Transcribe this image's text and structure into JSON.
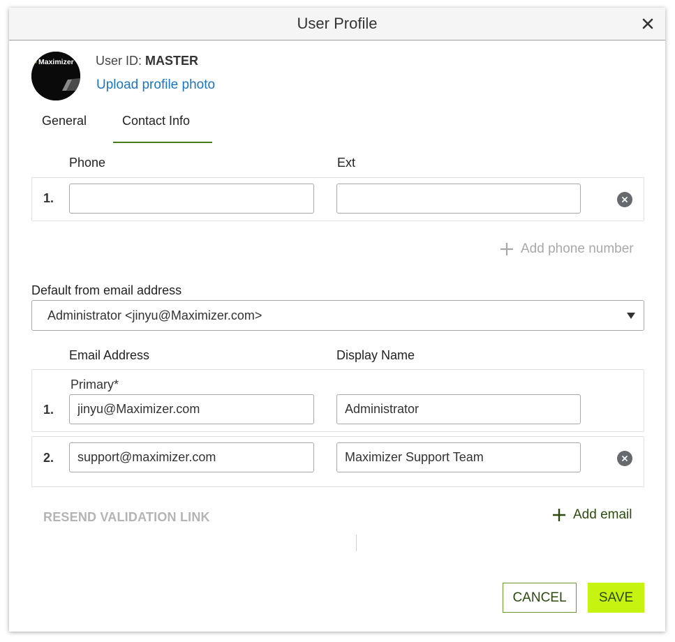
{
  "dialog": {
    "title": "User Profile",
    "close_icon": "close-icon"
  },
  "profile": {
    "user_id_label": "User ID:",
    "user_id_value": "MASTER",
    "upload_link": "Upload profile photo",
    "avatar_logo_text": "Maximizer"
  },
  "tabs": [
    {
      "label": "General",
      "active": false
    },
    {
      "label": "Contact Info",
      "active": true
    }
  ],
  "phone_section": {
    "phone_label": "Phone",
    "ext_label": "Ext",
    "rows": [
      {
        "number": "1.",
        "phone": "",
        "ext": ""
      }
    ],
    "add_label": "Add phone number"
  },
  "default_email": {
    "label": "Default from email address",
    "selected": "Administrator <jinyu@Maximizer.com>"
  },
  "email_section": {
    "email_label": "Email Address",
    "display_label": "Display Name",
    "primary_label": "Primary*",
    "rows": [
      {
        "number": "1.",
        "email": "jinyu@Maximizer.com",
        "display": "Administrator"
      },
      {
        "number": "2.",
        "email": "support@maximizer.com",
        "display": "Maximizer Support Team"
      }
    ],
    "resend_label": "RESEND VALIDATION LINK",
    "add_label": "Add email"
  },
  "footer": {
    "cancel_label": "CANCEL",
    "save_label": "SAVE"
  },
  "colors": {
    "accent_green": "#c6f30f",
    "dark_green": "#2c4a10",
    "link_blue": "#1976c2",
    "tab_underline": "#4a7a1c"
  }
}
